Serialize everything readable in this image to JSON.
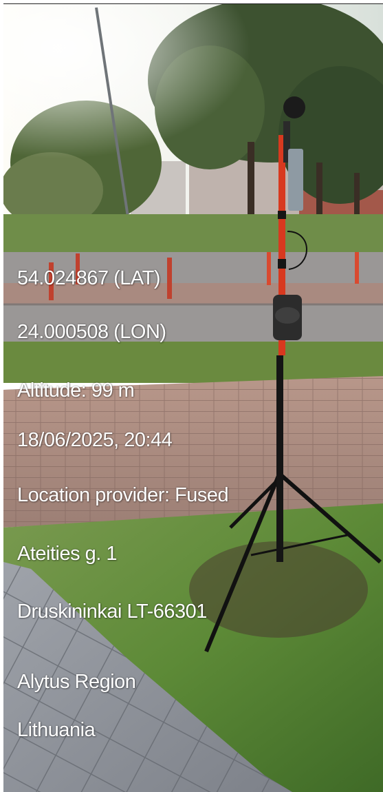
{
  "overlay": {
    "latitude": "54.024867 (LAT)",
    "longitude": "24.000508 (LON)",
    "altitude": "Altitude: 99 m",
    "datetime": "18/06/2025, 20:44",
    "provider": "Location provider: Fused",
    "street": "Ateities g. 1",
    "city": "Druskininkai LT-66301",
    "region": "Alytus Region",
    "country": "Lithuania"
  }
}
